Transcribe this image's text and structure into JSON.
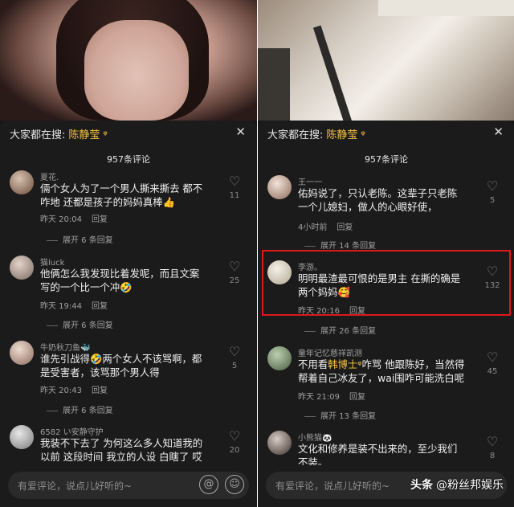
{
  "left": {
    "search_label": "大家都在搜:",
    "search_keyword": "陈静莹",
    "comment_count": "957条评论",
    "comments": [
      {
        "name": "夏花.",
        "text": "倆个女人为了一个男人撕来撕去 都不咋地 还都是孩子的妈妈真棒👍",
        "time": "昨天 20:04",
        "reply": "回复",
        "expand": "展开 6 条回复",
        "likes": "11"
      },
      {
        "name": "猫luck",
        "text": "他俩怎么我发现比着发呢，而且文案写的一个比一个冲🤣",
        "time": "昨天 19:44",
        "reply": "回复",
        "expand": "展开 6 条回复",
        "likes": "25"
      },
      {
        "name": "牛奶秋刀鱼🐳",
        "text": "谁先引战得🤣两个女人不该骂啊，都是受害者，该骂那个男人得",
        "time": "昨天 20:43",
        "reply": "回复",
        "expand": "展开 6 条回复",
        "likes": "5"
      },
      {
        "name": "6582 い安静守护",
        "text": "我装不下去了 为何这么多人知道我的以前 这段时间 我立的人设 白瞎了 哎",
        "likes": "20"
      }
    ],
    "input_placeholder": "有爱评论，说点儿好听的~"
  },
  "right": {
    "search_label": "大家都在搜:",
    "search_keyword": "陈静莹",
    "comment_count": "957条评论",
    "comments": [
      {
        "name": "王一一",
        "text": "佑妈说了，只认老陈。这辈子只老陈一个儿媳妇，做人的心眼好使，",
        "time": "4小时前",
        "reply": "回复",
        "expand": "展开 14 条回复",
        "likes": "5"
      },
      {
        "name": "李游。",
        "text": "明明最渣最可恨的是男主 在撕的确是两个妈妈🥰",
        "time": "昨天 20:16",
        "reply": "回复",
        "expand": "展开 26 条回复",
        "likes": "132"
      },
      {
        "name": "童年记忆慈祥凯测",
        "text_a": "不用看",
        "text_b": "韩博士",
        "text_c": "咋骂 他跟陈好，当然得帮着自己冰友了，wai围咋可能洗白呢",
        "time": "昨天 21:09",
        "reply": "回复",
        "expand": "展开 13 条回复",
        "likes": "45"
      },
      {
        "name": "小熊猫🐼",
        "text": "文化和修养是装不出来的，至少我们不装。",
        "likes": "8"
      }
    ],
    "input_placeholder": "有爱评论，说点儿好听的~",
    "watermark_a": "头条",
    "watermark_b": "@粉丝邦娱乐"
  },
  "icons": {
    "at": "@",
    "emoji": "☺",
    "heart": "♡",
    "close": "✕",
    "search_suffix": "ᵠ"
  },
  "colors": {
    "keyword": "#f5c244",
    "highlight_border": "#e01818",
    "background": "#1b1b1b"
  }
}
